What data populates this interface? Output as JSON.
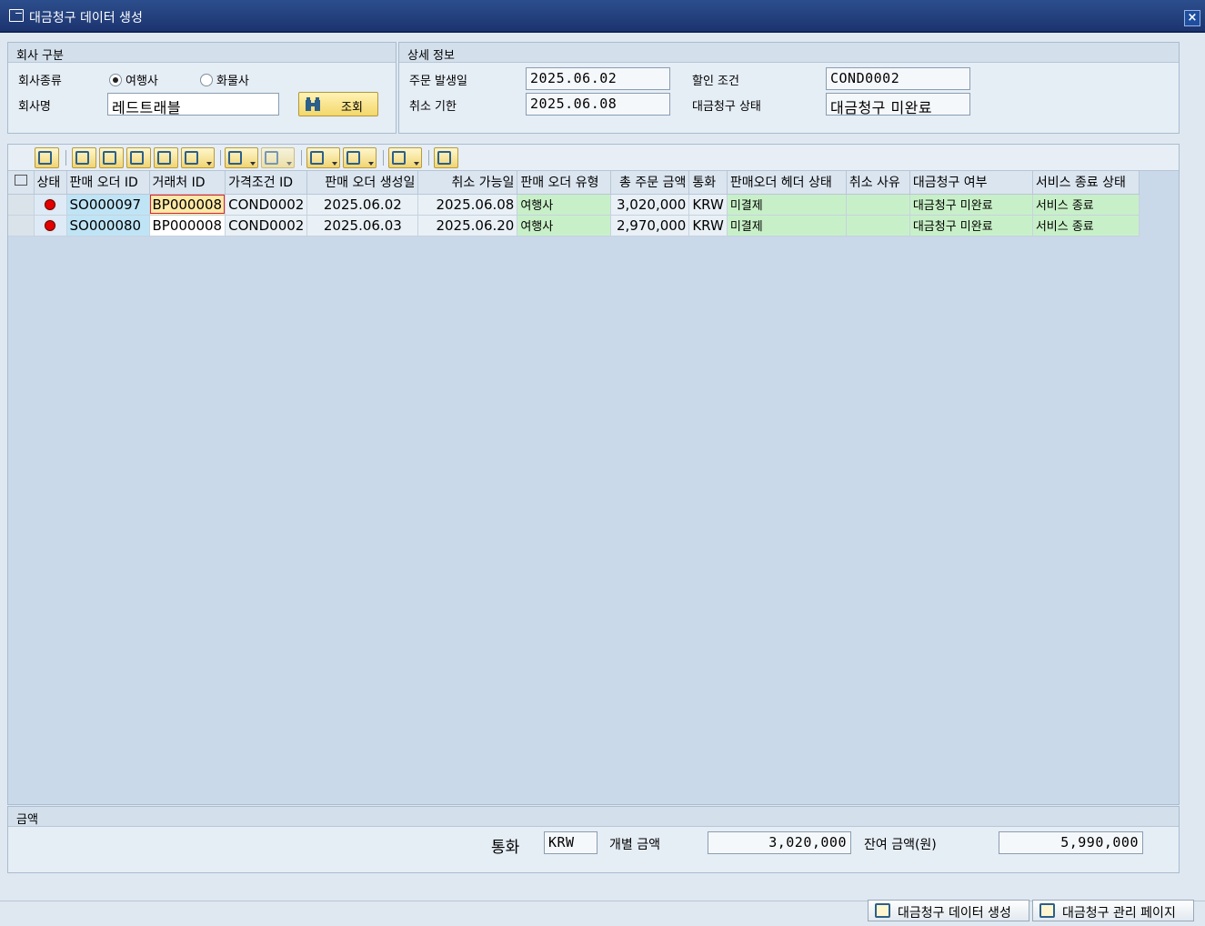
{
  "window": {
    "title": "대금청구 데이터 생성",
    "close": "×"
  },
  "company": {
    "header": "회사 구분",
    "type_label": "회사종류",
    "radio1": "여행사",
    "radio2": "화물사",
    "radio_selected": "여행사",
    "name_label": "회사명",
    "name_value": "레드트래블",
    "search_button": "조회"
  },
  "detail": {
    "header": "상세 정보",
    "order_date_label": "주문 발생일",
    "order_date": "2025.06.02",
    "cancel_deadline_label": "취소 기한",
    "cancel_deadline": "2025.06.08",
    "discount_label": "할인 조건",
    "discount": "COND0002",
    "billing_status_label": "대금청구 상태",
    "billing_status": "대금청구 미완료"
  },
  "grid": {
    "columns": [
      "상태",
      "판매 오더 ID",
      "거래처 ID",
      "가격조건 ID",
      "판매 오더 생성일",
      "취소 가능일",
      "판매 오더 유형",
      "총 주문 금액",
      "통화",
      "판매오더 헤더 상태",
      "취소 사유",
      "대금청구 여부",
      "서비스 종료 상태"
    ],
    "rows": [
      {
        "status": "red",
        "so_id": "SO000097",
        "bp_id": "BP000008",
        "cond_id": "COND0002",
        "created": "2025.06.02",
        "cancel_date": "2025.06.08",
        "type": "여행사",
        "amount": "3,020,000",
        "currency": "KRW",
        "header_status": "미결제",
        "cancel_reason": "",
        "billing": "대금청구 미완료",
        "service": "서비스 종료"
      },
      {
        "status": "red",
        "so_id": "SO000080",
        "bp_id": "BP000008",
        "cond_id": "COND0002",
        "created": "2025.06.03",
        "cancel_date": "2025.06.20",
        "type": "여행사",
        "amount": "2,970,000",
        "currency": "KRW",
        "header_status": "미결제",
        "cancel_reason": "",
        "billing": "대금청구 미완료",
        "service": "서비스 종료"
      }
    ]
  },
  "amount": {
    "header": "금액",
    "currency_label": "통화",
    "currency": "KRW",
    "individual_label": "개별 금액",
    "individual": "3,020,000",
    "remaining_label": "잔여 금액(원)",
    "remaining": "5,990,000"
  },
  "footer": {
    "create_button": "대금청구 데이터 생성",
    "manage_button": "대금청구 관리 페이지"
  },
  "toolbar_icons": [
    "details-icon",
    "sort-asc-icon",
    "sort-desc-icon",
    "find-icon",
    "find-next-icon",
    "filter-icon",
    "sum-icon",
    "subtotal-icon",
    "print-icon",
    "export-icon",
    "layout-icon",
    "info-icon"
  ]
}
